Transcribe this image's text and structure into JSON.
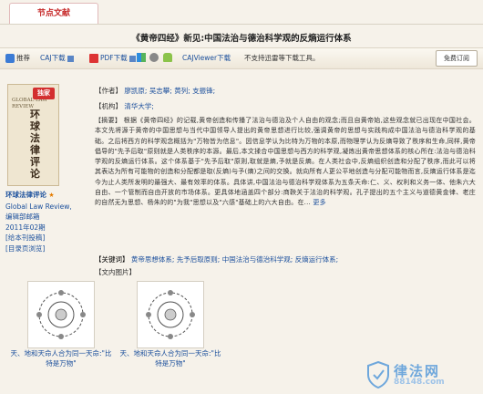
{
  "tab": {
    "label": "节点文献"
  },
  "title": "《黄帝四经》新见:中国法治与德治科学观的反熵运行体系",
  "downloads": {
    "recommend_label": "推荐",
    "caj_label": "CAJ下载",
    "pdf_label": "PDF下载",
    "cajviewer_label": "CAJViewer下载",
    "notice": "不支持迅雷等下载工具。",
    "free_button": "免费订阅"
  },
  "journal": {
    "cover_en": "GLOBAL LAW REVIEW",
    "cover_cn": "环球法律评论",
    "cover_badge": "独家",
    "name_cn": "环球法律评论",
    "name_en": "Global Law Review,",
    "editor": "编辑部邮箱",
    "issue": "2011年02期",
    "contribute": "[给本刊投稿]",
    "catalog": "[目录页浏览]"
  },
  "meta": {
    "author_label": "【作者】",
    "authors": [
      "廖凯原;",
      "吴志攀;",
      "黄列;",
      "支振锋;"
    ],
    "org_label": "【机构】",
    "org": "清华大学;",
    "abstract_label": "【摘要】",
    "abstract": "根据《黄帝四经》的记载,黄帝创造和传播了法治与德治及个人自由的观念;而且自黄帝始,这些观念就已出现在中国社会。本文先将源于黄帝的中国思想与当代中国领导人提出的黄帝思想进行比较,强调黄帝的思想与实践构成中国法治与德治科学观的基础。之后将西方的科学观念概括为\"万物皆为信息\"。因信息学认为比特为万物的本原,而物理学认为反熵导致了秩序和生命,同样,黄帝倡导的\"先予后取\"原则就是人类秩序的本源。最后,本文揉合中国思想与西方的科学观,凝炼出黄帝思想体系的核心所在:法治与德治科学观的反熵运行体系。这个体系基于\"先予后取\"原则,取就是熵,予就是反熵。在人类社会中,反熵组织创造和分配了秩序,而此可以将其表达为所有可能物的创造和分配都是取(反熵)与予(熵)之间的交换。就向所有人更公平地创造与分配可能物而言,反熵运行体系是迄今为止人类所发明的最强大、最有效率的体系。具体讲,中国法治与德治科学观体系为五条天命:仁、义、权利和义务一体、他朱六大自由、一个管制而自由开放的市场体系。更具体地涵盖四个部分:商鞅关于法治的科学观。孔子提出的五个主义与道德黄金律、老庄的自然无为思想、杨朱的的\"为我\"思想以及\"六感\"基础上的六大自由。在...",
    "more": "更多",
    "keywords_label": "【关键词】",
    "keywords": [
      "黄帝思想体系;",
      "先予后取原则;",
      "中国法治与德治科学观;",
      "反熵运行体系;"
    ],
    "figures_label": "【文内图片】"
  },
  "figures": [
    {
      "caption": "天、地和天命人合为同一天命:\"比特是万物\""
    },
    {
      "caption": "天、地和天命人合为同一天命:\"比特是万物\""
    }
  ],
  "watermark": {
    "title": "律法网",
    "url": "88148.com"
  },
  "colors": {
    "link": "#1b4f9c",
    "tab_red": "#c62828",
    "background": "#f6f2ea"
  }
}
